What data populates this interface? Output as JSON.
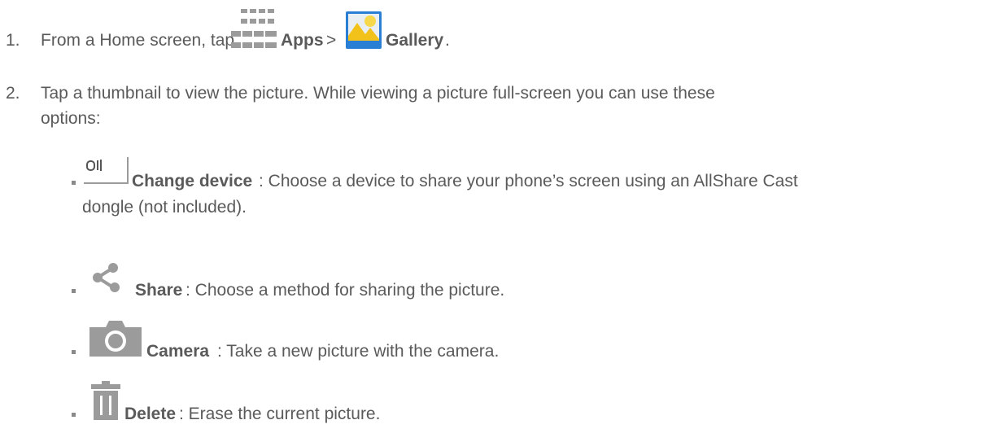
{
  "steps": [
    {
      "number": "1.",
      "pre": "From a Home screen, tap",
      "apps_label": "Apps",
      "sep": ">",
      "gallery_label": "Gallery",
      "end": "."
    },
    {
      "number": "2.",
      "line1": "Tap a thumbnail to view the picture. While viewing a picture full-screen you can use these",
      "line2": "options:"
    }
  ],
  "options": [
    {
      "icon": "change-device-icon",
      "label": "Change device",
      "desc1": ": Choose a device to share your phone’s screen using an AllShare Cast",
      "desc2": "dongle (not included)."
    },
    {
      "icon": "share-icon",
      "label": "Share",
      "desc1": ": Choose a method for sharing the picture."
    },
    {
      "icon": "camera-icon",
      "label": "Camera",
      "desc1": ": Take a new picture with the camera."
    },
    {
      "icon": "delete-icon",
      "label": "Delete",
      "desc1": ": Erase the current picture."
    }
  ],
  "colors": {
    "text": "#5a5a5a",
    "icon_gray": "#9b9b9b",
    "gallery_blue": "#2a7fd4",
    "gallery_yellow": "#f2c21a"
  }
}
